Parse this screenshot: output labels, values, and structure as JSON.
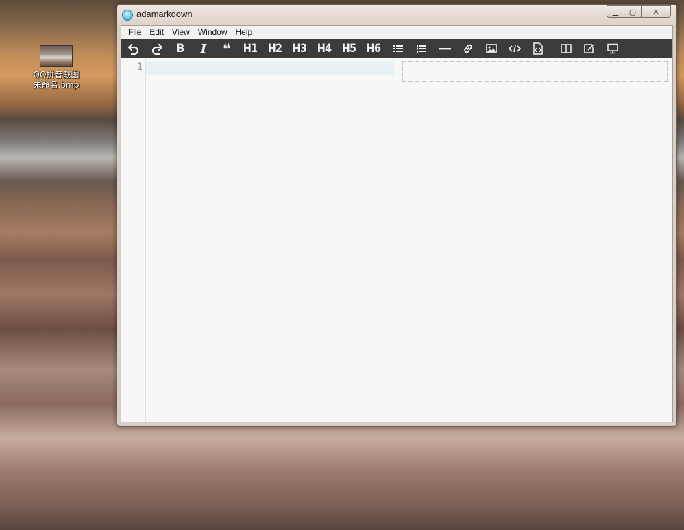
{
  "desktop": {
    "icon_label": "QQ拼音截图未命名.bmp"
  },
  "window": {
    "title": "adamarkdown",
    "controls": {
      "minimize": "▁",
      "maximize": "▢",
      "close": "✕"
    }
  },
  "menu": [
    "File",
    "Edit",
    "View",
    "Window",
    "Help"
  ],
  "toolbar": {
    "bold": "B",
    "italic": "I",
    "quote": "❝",
    "h1": "H1",
    "h2": "H2",
    "h3": "H3",
    "h4": "H4",
    "h5": "H5",
    "h6": "H6"
  },
  "editor": {
    "line_numbers": [
      "1"
    ],
    "content": ""
  },
  "colors": {
    "toolbar_bg": "#3b3b3b",
    "active_line": "#e8f2f4",
    "editor_bg": "#f8f8f7"
  }
}
